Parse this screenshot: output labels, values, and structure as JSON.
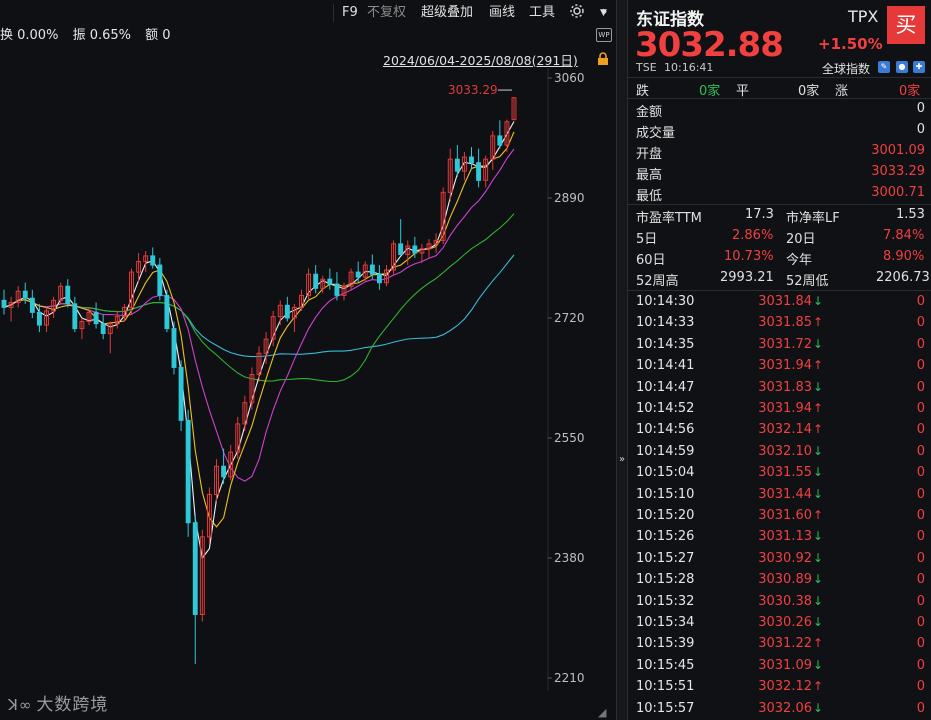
{
  "toolbar": {
    "f9": "F9",
    "no_adjust": "不复权",
    "super_overlay": "超级叠加",
    "draw_line": "画线",
    "tools": "工具",
    "settings_icon": "gear-icon",
    "collapse_icon": "chevron-down-icon",
    "more_icon": "chevron-right-icon"
  },
  "info_line": {
    "turnover": "换 0.00%",
    "amplitude": "振 0.65%",
    "amount": "额 0"
  },
  "date_range": "2024/06/04-2025/08/08(291日)",
  "watermark": "大数跨境",
  "chart_data": {
    "type": "candlestick",
    "y_ticks": [
      "3060",
      "2890",
      "2720",
      "2550",
      "2380",
      "2210"
    ],
    "ylim": [
      2210,
      3060
    ],
    "annotation": "3033.29",
    "colors": {
      "up": "#e03a3a",
      "down": "#2ec8d8",
      "ma5": "#f2f2f2",
      "ma10": "#f0c020",
      "ma20": "#d040d0",
      "ma60": "#30b030",
      "ma120": "#3ab8d8"
    },
    "candles": [
      [
        2745,
        2760,
        2725,
        2735
      ],
      [
        2735,
        2750,
        2715,
        2742
      ],
      [
        2742,
        2765,
        2735,
        2758
      ],
      [
        2758,
        2770,
        2740,
        2748
      ],
      [
        2748,
        2760,
        2720,
        2728
      ],
      [
        2728,
        2740,
        2700,
        2710
      ],
      [
        2710,
        2735,
        2700,
        2730
      ],
      [
        2730,
        2750,
        2720,
        2745
      ],
      [
        2745,
        2770,
        2740,
        2765
      ],
      [
        2765,
        2775,
        2735,
        2740
      ],
      [
        2740,
        2750,
        2700,
        2705
      ],
      [
        2705,
        2720,
        2690,
        2715
      ],
      [
        2715,
        2735,
        2710,
        2728
      ],
      [
        2728,
        2742,
        2705,
        2712
      ],
      [
        2712,
        2725,
        2690,
        2698
      ],
      [
        2698,
        2715,
        2670,
        2712
      ],
      [
        2712,
        2730,
        2705,
        2722
      ],
      [
        2722,
        2740,
        2715,
        2735
      ],
      [
        2735,
        2790,
        2725,
        2785
      ],
      [
        2785,
        2812,
        2770,
        2800
      ],
      [
        2800,
        2815,
        2785,
        2808
      ],
      [
        2808,
        2820,
        2790,
        2795
      ],
      [
        2795,
        2805,
        2745,
        2752
      ],
      [
        2752,
        2760,
        2700,
        2705
      ],
      [
        2705,
        2715,
        2640,
        2650
      ],
      [
        2650,
        2660,
        2560,
        2575
      ],
      [
        2575,
        2590,
        2410,
        2430
      ],
      [
        2430,
        2440,
        2230,
        2300
      ],
      [
        2300,
        2420,
        2290,
        2410
      ],
      [
        2410,
        2480,
        2400,
        2470
      ],
      [
        2470,
        2520,
        2460,
        2510
      ],
      [
        2510,
        2535,
        2485,
        2495
      ],
      [
        2495,
        2540,
        2490,
        2530
      ],
      [
        2530,
        2580,
        2520,
        2570
      ],
      [
        2570,
        2610,
        2560,
        2600
      ],
      [
        2600,
        2650,
        2590,
        2640
      ],
      [
        2640,
        2680,
        2630,
        2670
      ],
      [
        2670,
        2700,
        2655,
        2690
      ],
      [
        2690,
        2730,
        2680,
        2722
      ],
      [
        2722,
        2745,
        2710,
        2738
      ],
      [
        2738,
        2750,
        2715,
        2720
      ],
      [
        2720,
        2740,
        2700,
        2735
      ],
      [
        2735,
        2760,
        2730,
        2752
      ],
      [
        2752,
        2790,
        2745,
        2782
      ],
      [
        2782,
        2795,
        2755,
        2762
      ],
      [
        2762,
        2780,
        2755,
        2775
      ],
      [
        2775,
        2790,
        2760,
        2768
      ],
      [
        2768,
        2785,
        2745,
        2752
      ],
      [
        2752,
        2770,
        2745,
        2765
      ],
      [
        2765,
        2790,
        2760,
        2785
      ],
      [
        2785,
        2800,
        2770,
        2778
      ],
      [
        2778,
        2800,
        2772,
        2795
      ],
      [
        2795,
        2810,
        2775,
        2782
      ],
      [
        2782,
        2795,
        2760,
        2770
      ],
      [
        2770,
        2795,
        2765,
        2788
      ],
      [
        2788,
        2830,
        2780,
        2825
      ],
      [
        2825,
        2860,
        2815,
        2810
      ],
      [
        2810,
        2830,
        2795,
        2822
      ],
      [
        2822,
        2835,
        2805,
        2812
      ],
      [
        2812,
        2825,
        2798,
        2818
      ],
      [
        2818,
        2832,
        2805,
        2825
      ],
      [
        2825,
        2840,
        2812,
        2830
      ],
      [
        2830,
        2905,
        2825,
        2898
      ],
      [
        2898,
        2960,
        2885,
        2945
      ],
      [
        2945,
        2965,
        2920,
        2928
      ],
      [
        2928,
        2955,
        2915,
        2948
      ],
      [
        2948,
        2962,
        2930,
        2940
      ],
      [
        2940,
        2960,
        2905,
        2915
      ],
      [
        2915,
        2950,
        2905,
        2945
      ],
      [
        2945,
        2985,
        2930,
        2978
      ],
      [
        2978,
        3000,
        2960,
        2965
      ],
      [
        2965,
        3001,
        2955,
        2998
      ],
      [
        3001,
        3033,
        3000,
        3032
      ]
    ]
  },
  "panel": {
    "name": "东证指数",
    "code": "TPX",
    "buy": "买",
    "price": "3032.88",
    "change_pct": "+1.50%",
    "exchange": "TSE",
    "time": "10:16:41",
    "global_index": "全球指数",
    "breadth": {
      "fall_label": "跌",
      "fall_value": "0家",
      "flat_label": "平",
      "flat_value": "0家",
      "rise_label": "涨",
      "rise_value": "0家"
    },
    "amount_label": "金额",
    "amount_value": "0",
    "volume_label": "成交量",
    "volume_value": "0",
    "open_label": "开盘",
    "open_value": "3001.09",
    "high_label": "最高",
    "high_value": "3033.29",
    "low_label": "最低",
    "low_value": "3000.71",
    "pe_label": "市盈率TTM",
    "pe_value": "17.3",
    "pb_label": "市净率LF",
    "pb_value": "1.53",
    "d5_label": "5日",
    "d5_value": "2.86%",
    "d20_label": "20日",
    "d20_value": "7.84%",
    "d60_label": "60日",
    "d60_value": "10.73%",
    "ytd_label": "今年",
    "ytd_value": "8.90%",
    "w52h_label": "52周高",
    "w52h_value": "2993.21",
    "w52l_label": "52周低",
    "w52l_value": "2206.73",
    "ticks": [
      {
        "time": "10:14:30",
        "price": "3031.84",
        "dir": "down",
        "vol": "0"
      },
      {
        "time": "10:14:33",
        "price": "3031.85",
        "dir": "up",
        "vol": "0"
      },
      {
        "time": "10:14:35",
        "price": "3031.72",
        "dir": "down",
        "vol": "0"
      },
      {
        "time": "10:14:41",
        "price": "3031.94",
        "dir": "up",
        "vol": "0"
      },
      {
        "time": "10:14:47",
        "price": "3031.83",
        "dir": "down",
        "vol": "0"
      },
      {
        "time": "10:14:52",
        "price": "3031.94",
        "dir": "up",
        "vol": "0"
      },
      {
        "time": "10:14:56",
        "price": "3032.14",
        "dir": "up",
        "vol": "0"
      },
      {
        "time": "10:14:59",
        "price": "3032.10",
        "dir": "down",
        "vol": "0"
      },
      {
        "time": "10:15:04",
        "price": "3031.55",
        "dir": "down",
        "vol": "0"
      },
      {
        "time": "10:15:10",
        "price": "3031.44",
        "dir": "down",
        "vol": "0"
      },
      {
        "time": "10:15:20",
        "price": "3031.60",
        "dir": "up",
        "vol": "0"
      },
      {
        "time": "10:15:26",
        "price": "3031.13",
        "dir": "down",
        "vol": "0"
      },
      {
        "time": "10:15:27",
        "price": "3030.92",
        "dir": "down",
        "vol": "0"
      },
      {
        "time": "10:15:28",
        "price": "3030.89",
        "dir": "down",
        "vol": "0"
      },
      {
        "time": "10:15:32",
        "price": "3030.38",
        "dir": "down",
        "vol": "0"
      },
      {
        "time": "10:15:34",
        "price": "3030.26",
        "dir": "down",
        "vol": "0"
      },
      {
        "time": "10:15:39",
        "price": "3031.22",
        "dir": "up",
        "vol": "0"
      },
      {
        "time": "10:15:45",
        "price": "3031.09",
        "dir": "down",
        "vol": "0"
      },
      {
        "time": "10:15:51",
        "price": "3032.12",
        "dir": "up",
        "vol": "0"
      },
      {
        "time": "10:15:57",
        "price": "3032.06",
        "dir": "down",
        "vol": "0"
      }
    ]
  }
}
